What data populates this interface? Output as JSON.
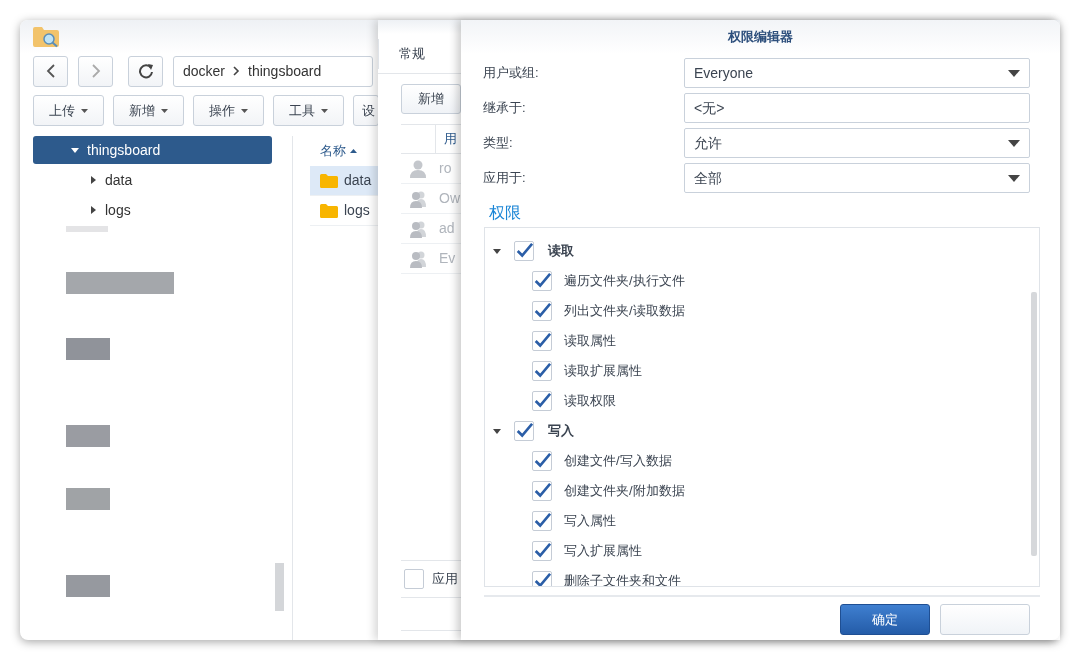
{
  "file_station": {
    "breadcrumb": [
      "docker",
      "thingsboard"
    ],
    "toolbar": [
      "上传",
      "新增",
      "操作",
      "工具",
      "设"
    ],
    "tree": [
      {
        "label": "thingsboard",
        "expanded": true,
        "selected": true,
        "children": [
          {
            "label": "data",
            "expanded": false,
            "selected": false
          },
          {
            "label": "logs",
            "expanded": false,
            "selected": false
          }
        ]
      }
    ],
    "list": {
      "column": "名称",
      "rows": [
        {
          "name": "data",
          "selected": true
        },
        {
          "name": "logs",
          "selected": false
        }
      ]
    }
  },
  "properties": {
    "tab": "常规",
    "add_button": "新增",
    "column": "用",
    "rows": [
      {
        "kind": "user",
        "name": "ro"
      },
      {
        "kind": "group",
        "name": "Ow"
      },
      {
        "kind": "group",
        "name": "ad"
      },
      {
        "kind": "group",
        "name": "Ev"
      }
    ],
    "apply_checkbox": {
      "label": "应用",
      "checked": false
    }
  },
  "dialog": {
    "title": "权限编辑器",
    "fields": [
      {
        "label": "用户或组:",
        "value": "Everyone",
        "kind": "dropdown"
      },
      {
        "label": "继承于:",
        "value": "<无>",
        "kind": "text"
      },
      {
        "label": "类型:",
        "value": "允许",
        "kind": "dropdown"
      },
      {
        "label": "应用于:",
        "value": "全部",
        "kind": "dropdown"
      }
    ],
    "section": "权限",
    "permissions": [
      {
        "label": "读取",
        "checked": true,
        "expanded": true,
        "children": [
          {
            "label": "遍历文件夹/执行文件",
            "checked": true
          },
          {
            "label": "列出文件夹/读取数据",
            "checked": true
          },
          {
            "label": "读取属性",
            "checked": true
          },
          {
            "label": "读取扩展属性",
            "checked": true
          },
          {
            "label": "读取权限",
            "checked": true
          }
        ]
      },
      {
        "label": "写入",
        "checked": true,
        "expanded": true,
        "children": [
          {
            "label": "创建文件/写入数据",
            "checked": true
          },
          {
            "label": "创建文件夹/附加数据",
            "checked": true
          },
          {
            "label": "写入属性",
            "checked": true
          },
          {
            "label": "写入扩展属性",
            "checked": true
          },
          {
            "label": "删除子文件夹和文件",
            "checked": true
          }
        ]
      }
    ],
    "buttons": [
      {
        "kind": "primary",
        "label": "确定"
      },
      {
        "kind": "secondary"
      }
    ]
  }
}
